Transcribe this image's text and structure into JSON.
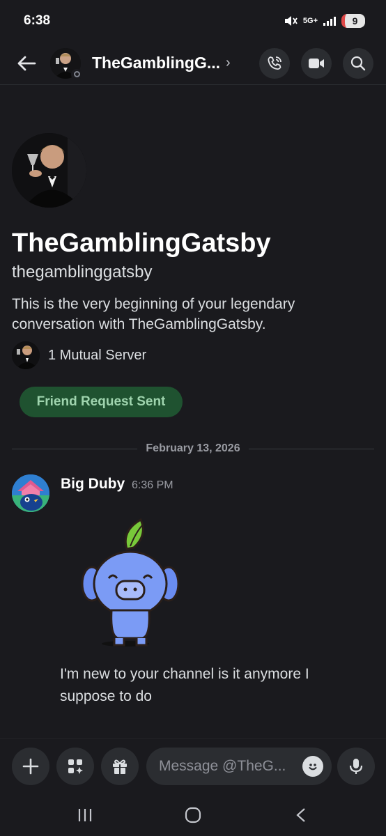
{
  "status_bar": {
    "time": "6:38",
    "network": "5G+",
    "battery": "9"
  },
  "header": {
    "title": "TheGamblingG...",
    "chevron": "›",
    "icons": [
      "back-arrow-icon",
      "call-icon",
      "video-icon",
      "search-icon"
    ]
  },
  "profile": {
    "display_name": "TheGamblingGatsby",
    "username": "thegamblinggatsby",
    "intro": "This is the very beginning of your legendary conversation with TheGamblingGatsby.",
    "mutual_servers": "1 Mutual Server",
    "friend_request_label": "Friend Request Sent"
  },
  "divider": {
    "date": "February 13, 2026"
  },
  "message": {
    "author": "Big Duby",
    "time": "6:36 PM",
    "text": "I'm new to your channel is it anymore I suppose to do"
  },
  "composer": {
    "placeholder": "Message @TheG..."
  },
  "colors": {
    "background": "#1a1a1e",
    "button_bg": "#2b2d31",
    "friend_button_bg": "#1f5230",
    "friend_button_text": "#9fd4ae"
  }
}
